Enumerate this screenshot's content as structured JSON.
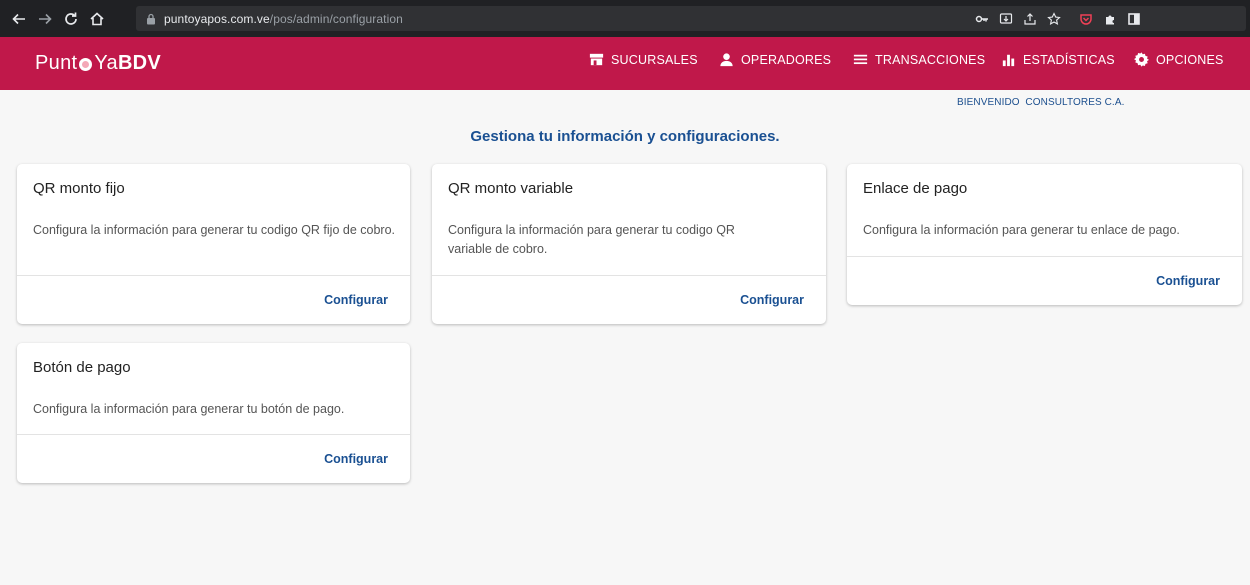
{
  "browser": {
    "url_host": "puntoyapos.com.ve",
    "url_path": "/pos/admin/configuration"
  },
  "header": {
    "brand_part1": "Punt",
    "brand_part2": "Ya",
    "brand_part3": "BDV",
    "bg_color": "#c0184a",
    "menu": [
      {
        "label": "SUCURSALES",
        "icon": "store-icon"
      },
      {
        "label": "OPERADORES",
        "icon": "person-icon"
      },
      {
        "label": "TRANSACCIONES",
        "icon": "list-icon"
      },
      {
        "label": "ESTADÍSTICAS",
        "icon": "bar-chart-icon"
      },
      {
        "label": "OPCIONES",
        "icon": "gear-icon"
      }
    ]
  },
  "welcome": "BIENVENIDO  CONSULTORES C.A.",
  "page_title": "Gestiona tu información y configuraciones.",
  "cards": [
    {
      "title": "QR monto fijo",
      "description": "Configura la información para generar tu codigo QR fijo de cobro.",
      "action": "Configurar"
    },
    {
      "title": "QR monto variable",
      "description": "Configura la información para generar tu codigo QR variable de cobro.",
      "action": "Configurar"
    },
    {
      "title": "Enlace de pago",
      "description": "Configura la información para generar tu enlace de pago.",
      "action": "Configurar"
    },
    {
      "title": "Botón de pago",
      "description": "Configura la información para generar tu botón de pago.",
      "action": "Configurar"
    }
  ],
  "colors": {
    "accent_blue": "#1a5092",
    "background": "#f7f7f7"
  }
}
